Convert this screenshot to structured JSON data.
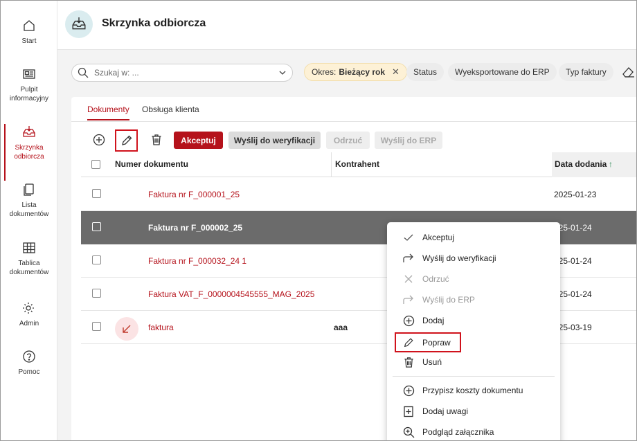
{
  "nav": {
    "start": "Start",
    "pulpit_1": "Pulpit",
    "pulpit_2": "informacyjny",
    "skrzynka_1": "Skrzynka",
    "skrzynka_2": "odbiorcza",
    "lista_1": "Lista",
    "lista_2": "dokumentów",
    "tablica_1": "Tablica",
    "tablica_2": "dokumentów",
    "admin": "Admin",
    "pomoc": "Pomoc"
  },
  "header": {
    "title": "Skrzynka odbiorcza"
  },
  "filters": {
    "search_placeholder": "Szukaj w: ...",
    "period_label": "Okres:",
    "period_value": "Bieżący rok",
    "status": "Status",
    "exported": "Wyeksportowane do ERP",
    "invoice_type": "Typ faktury"
  },
  "tabs": {
    "documents": "Dokumenty",
    "customer_service": "Obsługa klienta"
  },
  "toolbar": {
    "accept": "Akceptuj",
    "send_verification": "Wyślij do weryfikacji",
    "reject": "Odrzuć",
    "send_erp": "Wyślij do ERP"
  },
  "table": {
    "col_number": "Numer dokumentu",
    "col_contractor": "Kontrahent",
    "col_date": "Data dodania",
    "sort_icon": "↑",
    "rows": [
      {
        "number": "Faktura nr F_000001_25",
        "contractor": "",
        "date": "2025-01-23"
      },
      {
        "number": "Faktura nr F_000002_25",
        "contractor": "",
        "date": "025-01-24"
      },
      {
        "number": "Faktura nr F_000032_24 1",
        "contractor": "",
        "date": "025-01-24"
      },
      {
        "number": "Faktura VAT_F_0000004545555_MAG_2025",
        "contractor": "",
        "date": "025-01-24"
      },
      {
        "number": "faktura",
        "contractor": "aaa",
        "date": "025-03-19"
      }
    ]
  },
  "menu": {
    "accept": "Akceptuj",
    "send_verification": "Wyślij do weryfikacji",
    "reject": "Odrzuć",
    "send_erp": "Wyślij do ERP",
    "add": "Dodaj",
    "edit": "Popraw",
    "delete": "Usuń",
    "assign_costs": "Przypisz koszty dokumentu",
    "add_notes": "Dodaj uwagi",
    "preview_attachment": "Podgląd załącznika"
  },
  "colors": {
    "accent": "#b5121b",
    "selected_row": "#6b6b6b",
    "highlight_box": "#d0121c"
  }
}
